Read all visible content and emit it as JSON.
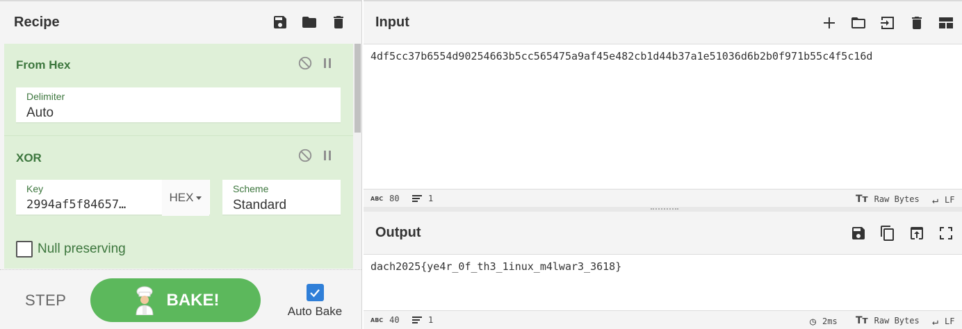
{
  "recipe": {
    "title": "Recipe",
    "icons": [
      "save-icon",
      "folder-icon",
      "trash-icon"
    ],
    "operations": [
      {
        "name": "From Hex",
        "delimiter_label": "Delimiter",
        "delimiter_value": "Auto"
      },
      {
        "name": "XOR",
        "key_label": "Key",
        "key_value": "2994af5f84657…",
        "key_format": "HEX",
        "scheme_label": "Scheme",
        "scheme_value": "Standard",
        "null_preserving_label": "Null preserving",
        "null_preserving": false
      }
    ]
  },
  "controls": {
    "step_label": "STEP",
    "bake_label": "BAKE!",
    "auto_bake_label": "Auto Bake",
    "auto_bake_checked": true
  },
  "input": {
    "title": "Input",
    "icons": [
      "plus-icon",
      "folder-icon",
      "import-icon",
      "trash-icon",
      "layout-icon"
    ],
    "text": "4df5cc37b6554d90254663b5cc565475a9af45e482cb1d44b37a1e51036d6b2b0f971b55c4f5c16d",
    "stats": {
      "chars": "80",
      "lines": "1",
      "encoding": "Raw Bytes",
      "eol": "LF"
    }
  },
  "output": {
    "title": "Output",
    "icons": [
      "save-icon",
      "copy-icon",
      "replace-input-icon",
      "maximize-icon"
    ],
    "text": "dach2025{ye4r_0f_th3_1inux_m4lwar3_3618}",
    "stats": {
      "chars": "40",
      "lines": "1",
      "time": "2ms",
      "encoding": "Raw Bytes",
      "eol": "LF"
    }
  },
  "colors": {
    "op_background": "#dff0d8",
    "op_title": "#3c763d",
    "bake_button": "#5cb85c",
    "auto_bake_check": "#2f7fd8"
  }
}
